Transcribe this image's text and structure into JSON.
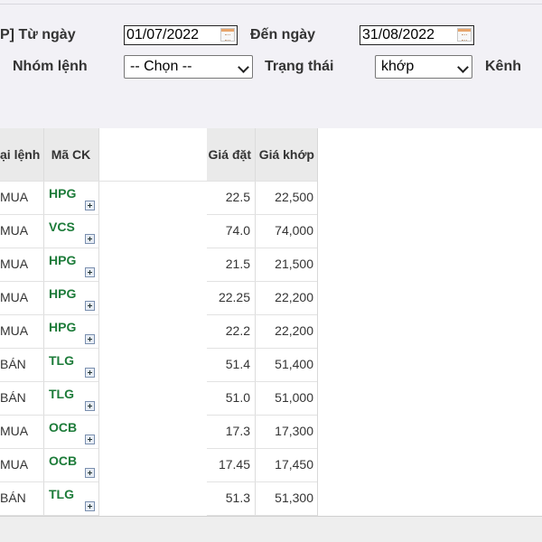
{
  "filters": {
    "from_date_label": "P] Từ ngày",
    "from_date_value": "01/07/2022",
    "to_date_label": "Đến ngày",
    "to_date_value": "31/08/2022",
    "order_group_label": "Nhóm lệnh",
    "order_group_selected": "-- Chọn --",
    "status_label": "Trạng thái",
    "status_selected": "khớp",
    "channel_label": "Kênh"
  },
  "table": {
    "columns": {
      "order_type": "ại lệnh",
      "symbol": "Mã CK",
      "order_price": "Giá đặt",
      "match_price": "Giá khớp"
    },
    "rows": [
      {
        "order_type": "MUA",
        "symbol": "HPG",
        "order_price": "22.5",
        "match_price": "22,500"
      },
      {
        "order_type": "MUA",
        "symbol": "VCS",
        "order_price": "74.0",
        "match_price": "74,000"
      },
      {
        "order_type": "MUA",
        "symbol": "HPG",
        "order_price": "21.5",
        "match_price": "21,500"
      },
      {
        "order_type": "MUA",
        "symbol": "HPG",
        "order_price": "22.25",
        "match_price": "22,200"
      },
      {
        "order_type": "MUA",
        "symbol": "HPG",
        "order_price": "22.2",
        "match_price": "22,200"
      },
      {
        "order_type": "BÁN",
        "symbol": "TLG",
        "order_price": "51.4",
        "match_price": "51,400"
      },
      {
        "order_type": "BÁN",
        "symbol": "TLG",
        "order_price": "51.0",
        "match_price": "51,000"
      },
      {
        "order_type": "MUA",
        "symbol": "OCB",
        "order_price": "17.3",
        "match_price": "17,300"
      },
      {
        "order_type": "MUA",
        "symbol": "OCB",
        "order_price": "17.45",
        "match_price": "17,450"
      },
      {
        "order_type": "BÁN",
        "symbol": "TLG",
        "order_price": "51.3",
        "match_price": "51,300"
      }
    ]
  },
  "colors": {
    "panel_bg": "#f2f1f6",
    "ticker_green": "#1c7b39",
    "header_bg": "#eaeaea"
  },
  "icons": {
    "calendar": "calendar-icon",
    "expand": "plus-box-icon",
    "dropdown": "chevron-down-icon"
  }
}
